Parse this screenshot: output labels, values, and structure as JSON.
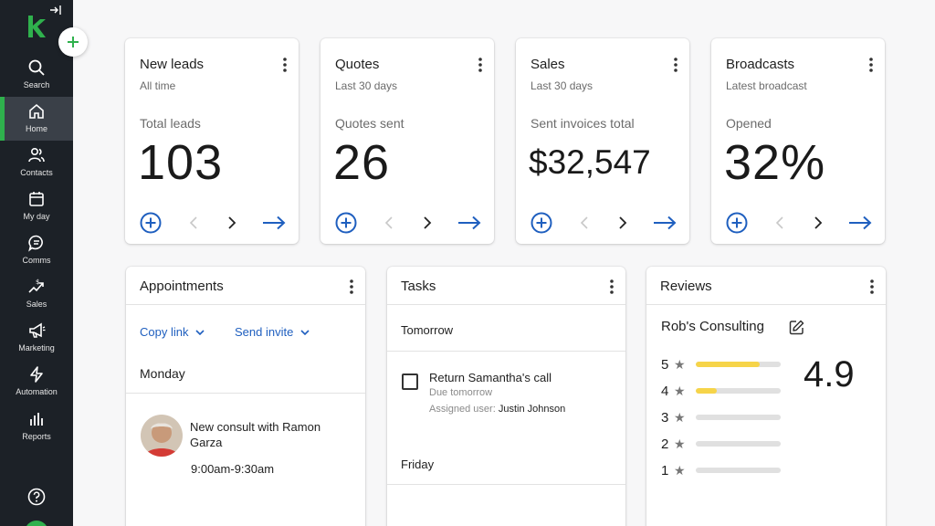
{
  "sidebar": {
    "items": [
      {
        "label": "Search",
        "icon": "search-icon"
      },
      {
        "label": "Home",
        "icon": "home-icon",
        "active": true
      },
      {
        "label": "Contacts",
        "icon": "contacts-icon"
      },
      {
        "label": "My day",
        "icon": "calendar-icon"
      },
      {
        "label": "Comms",
        "icon": "chat-icon"
      },
      {
        "label": "Sales",
        "icon": "sales-icon"
      },
      {
        "label": "Marketing",
        "icon": "megaphone-icon"
      },
      {
        "label": "Automation",
        "icon": "lightning-icon"
      },
      {
        "label": "Reports",
        "icon": "bar-chart-icon"
      }
    ],
    "accent": "#2fb14d"
  },
  "kpis": [
    {
      "title": "New leads",
      "subtitle": "All time",
      "metric_label": "Total leads",
      "value": "103"
    },
    {
      "title": "Quotes",
      "subtitle": "Last 30 days",
      "metric_label": "Quotes sent",
      "value": "26"
    },
    {
      "title": "Sales",
      "subtitle": "Last 30 days",
      "metric_label": "Sent invoices total",
      "value": "$32,547"
    },
    {
      "title": "Broadcasts",
      "subtitle": "Latest broadcast",
      "metric_label": "Opened",
      "value": "32%"
    }
  ],
  "appointments": {
    "title": "Appointments",
    "copy_link": "Copy link",
    "send_invite": "Send invite",
    "day": "Monday",
    "event_title": "New consult with Ramon Garza",
    "event_time": "9:00am-9:30am"
  },
  "tasks": {
    "title": "Tasks",
    "group1": "Tomorrow",
    "task_title": "Return Samantha's call",
    "task_due": "Due tomorrow",
    "assigned_label": "Assigned user:",
    "assigned_name": "Justin Johnson",
    "group2": "Friday"
  },
  "reviews": {
    "title": "Reviews",
    "business": "Rob's Consulting",
    "rating": "4.9",
    "distribution": [
      {
        "stars": "5",
        "fraction": 0.75
      },
      {
        "stars": "4",
        "fraction": 0.25
      },
      {
        "stars": "3",
        "fraction": 0
      },
      {
        "stars": "2",
        "fraction": 0
      },
      {
        "stars": "1",
        "fraction": 0
      }
    ]
  },
  "colors": {
    "link_blue": "#1f5fbf",
    "star_yellow": "#f6d449",
    "sidebar_bg": "#1c2127"
  }
}
